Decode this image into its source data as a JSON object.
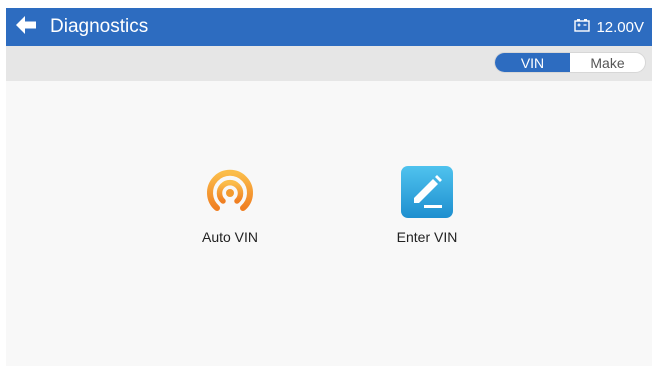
{
  "header": {
    "title": "Diagnostics",
    "battery_voltage": "12.00V",
    "back_icon": "arrow-left-icon",
    "battery_icon": "battery-icon",
    "color": "#2d6cc0"
  },
  "mode_toggle": {
    "tabs": [
      {
        "label": "VIN",
        "active": true
      },
      {
        "label": "Make",
        "active": false
      }
    ]
  },
  "options": [
    {
      "label": "Auto VIN",
      "icon": "auto-vin-signal-icon",
      "icon_color": "#f39a2e"
    },
    {
      "label": "Enter VIN",
      "icon": "edit-pencil-icon",
      "icon_color": "#2d9fd6"
    }
  ]
}
